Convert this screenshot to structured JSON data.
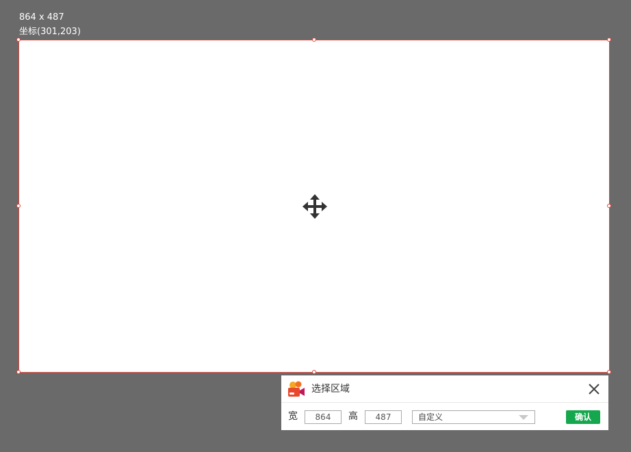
{
  "overlay": {
    "size_readout": "864 x 487",
    "coordinate_readout": "坐标(301,203)"
  },
  "selection": {
    "border_color": "#e0443a",
    "move_icon": "move-arrows-icon"
  },
  "panel": {
    "app_icon": "video-camera-icon",
    "title": "选择区域",
    "close_icon": "close-icon",
    "width_label": "宽",
    "width_value": "864",
    "height_label": "高",
    "height_value": "487",
    "preset_selected": "自定义",
    "dropdown_icon": "triangle-down-icon",
    "confirm_label": "确认",
    "confirm_color": "#15a74d"
  }
}
